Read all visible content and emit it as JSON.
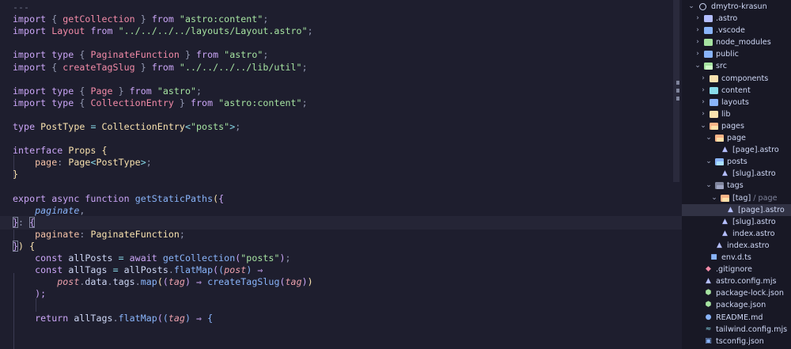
{
  "colors": {
    "editor_bg": "#1e1e2e",
    "sidebar_bg": "#181825",
    "keyword": "#cba6f7",
    "function": "#89b4fa",
    "type": "#f9e2af",
    "string": "#a6e3a1",
    "text": "#cdd6f4"
  },
  "explorer": {
    "root_label": "dmytro-krasun",
    "items": [
      {
        "label": "astro",
        "prefix": ".",
        "icon": "folder-astro-icon",
        "color": "#b4befe",
        "indent": 1,
        "chevron": "›",
        "kind": "folder"
      },
      {
        "label": ".vscode",
        "icon": "folder-vscode-icon",
        "color": "#89b4fa",
        "indent": 1,
        "chevron": "›",
        "kind": "folder"
      },
      {
        "label": "node_modules",
        "icon": "folder-node-icon",
        "color": "#a6e3a1",
        "indent": 1,
        "chevron": "›",
        "kind": "folder"
      },
      {
        "label": "public",
        "icon": "folder-public-icon",
        "color": "#89b4fa",
        "indent": 1,
        "chevron": "›",
        "kind": "folder"
      },
      {
        "label": "src",
        "icon": "folder-src-icon",
        "color": "#a6e3a1",
        "indent": 1,
        "chevron": "⌄",
        "kind": "folder-open"
      },
      {
        "label": "components",
        "icon": "folder-components-icon",
        "color": "#f9e2af",
        "indent": 2,
        "chevron": "›",
        "kind": "folder"
      },
      {
        "label": "content",
        "icon": "folder-content-icon",
        "color": "#89dceb",
        "indent": 2,
        "chevron": "›",
        "kind": "folder"
      },
      {
        "label": "layouts",
        "icon": "folder-layouts-icon",
        "color": "#89b4fa",
        "indent": 2,
        "chevron": "›",
        "kind": "folder"
      },
      {
        "label": "lib",
        "icon": "folder-lib-icon",
        "color": "#f9e2af",
        "indent": 2,
        "chevron": "›",
        "kind": "folder"
      },
      {
        "label": "pages",
        "icon": "folder-pages-icon",
        "color": "#fab387",
        "indent": 2,
        "chevron": "⌄",
        "kind": "folder-open"
      },
      {
        "label": "page",
        "icon": "folder-pages-icon",
        "color": "#fab387",
        "indent": 3,
        "chevron": "⌄",
        "kind": "folder-open"
      },
      {
        "label": "[page].astro",
        "icon": "astro-file-icon",
        "color": "#b4befe",
        "indent": 4,
        "chevron": "",
        "kind": "file"
      },
      {
        "label": "posts",
        "icon": "folder-posts-icon",
        "color": "#89b4fa",
        "indent": 3,
        "chevron": "⌄",
        "kind": "folder-open"
      },
      {
        "label": "[slug].astro",
        "icon": "astro-file-icon",
        "color": "#b4befe",
        "indent": 4,
        "chevron": "",
        "kind": "file"
      },
      {
        "label": "tags",
        "icon": "folder-tags-icon",
        "color": "#7f849c",
        "indent": 3,
        "chevron": "⌄",
        "kind": "folder-open"
      },
      {
        "label": "[tag]",
        "suffix": " / page",
        "icon": "folder-pages-icon",
        "color": "#fab387",
        "indent": 4,
        "chevron": "⌄",
        "kind": "folder-open"
      },
      {
        "label": "[page].astro",
        "icon": "astro-file-icon",
        "color": "#b4befe",
        "indent": 5,
        "chevron": "",
        "kind": "file",
        "selected": true
      },
      {
        "label": "[slug].astro",
        "icon": "astro-file-icon",
        "color": "#b4befe",
        "indent": 4,
        "chevron": "",
        "kind": "file"
      },
      {
        "label": "index.astro",
        "icon": "astro-file-icon",
        "color": "#b4befe",
        "indent": 4,
        "chevron": "",
        "kind": "file"
      },
      {
        "label": "index.astro",
        "icon": "astro-file-icon",
        "color": "#b4befe",
        "indent": 3,
        "chevron": "",
        "kind": "file"
      },
      {
        "label": "env.d.ts",
        "icon": "typescript-file-icon",
        "color": "#89b4fa",
        "indent": 2,
        "chevron": "",
        "kind": "file"
      },
      {
        "label": ".gitignore",
        "icon": "git-icon",
        "color": "#f38ba8",
        "indent": 1,
        "chevron": "",
        "kind": "file"
      },
      {
        "label": "astro.config.mjs",
        "icon": "astro-file-icon",
        "color": "#b4befe",
        "indent": 1,
        "chevron": "",
        "kind": "file"
      },
      {
        "label": "package-lock.json",
        "icon": "npm-icon",
        "color": "#a6e3a1",
        "indent": 1,
        "chevron": "",
        "kind": "file"
      },
      {
        "label": "package.json",
        "icon": "npm-icon",
        "color": "#a6e3a1",
        "indent": 1,
        "chevron": "",
        "kind": "file"
      },
      {
        "label": "README.md",
        "icon": "info-icon",
        "color": "#89b4fa",
        "indent": 1,
        "chevron": "",
        "kind": "file"
      },
      {
        "label": "tailwind.config.mjs",
        "icon": "tailwind-icon",
        "color": "#89dceb",
        "indent": 1,
        "chevron": "",
        "kind": "file"
      },
      {
        "label": "tsconfig.json",
        "icon": "tsconfig-icon",
        "color": "#89b4fa",
        "indent": 1,
        "chevron": "",
        "kind": "file"
      }
    ]
  },
  "editor": {
    "lines": [
      [
        [
          "---",
          "dim"
        ]
      ],
      [
        [
          "import",
          "kw"
        ],
        [
          " { ",
          "pu"
        ],
        [
          "getCollection",
          "pr"
        ],
        [
          " } ",
          "pu"
        ],
        [
          "from",
          "kw"
        ],
        [
          " ",
          "pl"
        ],
        [
          "\"astro:content\"",
          "str"
        ],
        [
          ";",
          "pu"
        ]
      ],
      [
        [
          "import",
          "kw"
        ],
        [
          " ",
          "pl"
        ],
        [
          "Layout",
          "pr"
        ],
        [
          " ",
          "pl"
        ],
        [
          "from",
          "kw"
        ],
        [
          " ",
          "pl"
        ],
        [
          "\"../../../../layouts/Layout.astro\"",
          "str"
        ],
        [
          ";",
          "pu"
        ]
      ],
      [],
      [
        [
          "import",
          "kw"
        ],
        [
          " ",
          "pl"
        ],
        [
          "type",
          "kw"
        ],
        [
          " { ",
          "pu"
        ],
        [
          "PaginateFunction",
          "pr"
        ],
        [
          " } ",
          "pu"
        ],
        [
          "from",
          "kw"
        ],
        [
          " ",
          "pl"
        ],
        [
          "\"astro\"",
          "str"
        ],
        [
          ";",
          "pu"
        ]
      ],
      [
        [
          "import",
          "kw"
        ],
        [
          " { ",
          "pu"
        ],
        [
          "createTagSlug",
          "pr"
        ],
        [
          " } ",
          "pu"
        ],
        [
          "from",
          "kw"
        ],
        [
          " ",
          "pl"
        ],
        [
          "\"../../../../lib/util\"",
          "str"
        ],
        [
          ";",
          "pu"
        ]
      ],
      [],
      [
        [
          "import",
          "kw"
        ],
        [
          " ",
          "pl"
        ],
        [
          "type",
          "kw"
        ],
        [
          " { ",
          "pu"
        ],
        [
          "Page",
          "pr"
        ],
        [
          " } ",
          "pu"
        ],
        [
          "from",
          "kw"
        ],
        [
          " ",
          "pl"
        ],
        [
          "\"astro\"",
          "str"
        ],
        [
          ";",
          "pu"
        ]
      ],
      [
        [
          "import",
          "kw"
        ],
        [
          " ",
          "pl"
        ],
        [
          "type",
          "kw"
        ],
        [
          " { ",
          "pu"
        ],
        [
          "CollectionEntry",
          "pr"
        ],
        [
          " } ",
          "pu"
        ],
        [
          "from",
          "kw"
        ],
        [
          " ",
          "pl"
        ],
        [
          "\"astro:content\"",
          "str"
        ],
        [
          ";",
          "pu"
        ]
      ],
      [],
      [
        [
          "type",
          "kw"
        ],
        [
          " ",
          "pl"
        ],
        [
          "PostType",
          "ty"
        ],
        [
          " ",
          "pl"
        ],
        [
          "=",
          "op"
        ],
        [
          " ",
          "pl"
        ],
        [
          "CollectionEntry",
          "ty"
        ],
        [
          "<",
          "op"
        ],
        [
          "\"posts\"",
          "str"
        ],
        [
          ">",
          "op"
        ],
        [
          ";",
          "pu"
        ]
      ],
      [],
      [
        [
          "interface",
          "kw"
        ],
        [
          " ",
          "pl"
        ],
        [
          "Props",
          "ty"
        ],
        [
          " ",
          "pl"
        ],
        [
          "{",
          "br1"
        ]
      ],
      [
        [
          "    ",
          "pl"
        ],
        [
          "page",
          "prk"
        ],
        [
          ": ",
          "pu"
        ],
        [
          "Page",
          "ty"
        ],
        [
          "<",
          "op"
        ],
        [
          "PostType",
          "ty"
        ],
        [
          ">",
          "op"
        ],
        [
          ";",
          "pu"
        ]
      ],
      [
        [
          "}",
          "br1"
        ]
      ],
      [],
      [
        [
          "export",
          "kw"
        ],
        [
          " ",
          "pl"
        ],
        [
          "async",
          "kw"
        ],
        [
          " ",
          "pl"
        ],
        [
          "function",
          "kw"
        ],
        [
          " ",
          "pl"
        ],
        [
          "getStaticPaths",
          "fn"
        ],
        [
          "(",
          "br1"
        ],
        [
          "{",
          "br2"
        ]
      ],
      [
        [
          "    ",
          "pl"
        ],
        [
          "paginate",
          "prop"
        ],
        [
          ",",
          "pu"
        ]
      ],
      [
        [
          "}",
          "br2box"
        ],
        [
          ": ",
          "pu"
        ],
        [
          "{",
          "br2box"
        ]
      ],
      [
        [
          "    ",
          "pl"
        ],
        [
          "paginate",
          "prk"
        ],
        [
          ": ",
          "pu"
        ],
        [
          "PaginateFunction",
          "ty"
        ],
        [
          ";",
          "pu"
        ]
      ],
      [
        [
          "}",
          "br2box"
        ],
        [
          ") ",
          "br1"
        ],
        [
          "{",
          "br1"
        ]
      ],
      [
        [
          "    ",
          "pl"
        ],
        [
          "const",
          "kw"
        ],
        [
          " ",
          "pl"
        ],
        [
          "allPosts",
          "pl"
        ],
        [
          " ",
          "pl"
        ],
        [
          "=",
          "op"
        ],
        [
          " ",
          "pl"
        ],
        [
          "await",
          "kw"
        ],
        [
          " ",
          "pl"
        ],
        [
          "getCollection",
          "fn"
        ],
        [
          "(",
          "br2"
        ],
        [
          "\"posts\"",
          "str"
        ],
        [
          ")",
          "br2"
        ],
        [
          ";",
          "pu"
        ]
      ],
      [
        [
          "    ",
          "pl"
        ],
        [
          "const",
          "kw"
        ],
        [
          " ",
          "pl"
        ],
        [
          "allTags",
          "pl"
        ],
        [
          " ",
          "pl"
        ],
        [
          "=",
          "op"
        ],
        [
          " ",
          "pl"
        ],
        [
          "allPosts",
          "pl"
        ],
        [
          ".",
          "pu"
        ],
        [
          "flatMap",
          "fn"
        ],
        [
          "(",
          "br2"
        ],
        [
          "(",
          "br3"
        ],
        [
          "post",
          "par"
        ],
        [
          ")",
          "br3"
        ],
        [
          " ⇒",
          "kw"
        ]
      ],
      [
        [
          "        ",
          "pl"
        ],
        [
          "post",
          "par"
        ],
        [
          ".",
          "pu"
        ],
        [
          "data",
          "pl"
        ],
        [
          ".",
          "pu"
        ],
        [
          "tags",
          "pl"
        ],
        [
          ".",
          "pu"
        ],
        [
          "map",
          "fn"
        ],
        [
          "(",
          "br1"
        ],
        [
          "(",
          "br2"
        ],
        [
          "tag",
          "par"
        ],
        [
          ")",
          "br2"
        ],
        [
          " ⇒ ",
          "kw"
        ],
        [
          "createTagSlug",
          "fn"
        ],
        [
          "(",
          "br2"
        ],
        [
          "tag",
          "par"
        ],
        [
          ")",
          "br2"
        ],
        [
          ")",
          "br1"
        ]
      ],
      [
        [
          "    ",
          "pl"
        ],
        [
          ");",
          "br2"
        ]
      ],
      [],
      [
        [
          "    ",
          "pl"
        ],
        [
          "return",
          "kw"
        ],
        [
          " ",
          "pl"
        ],
        [
          "allTags",
          "pl"
        ],
        [
          ".",
          "pu"
        ],
        [
          "flatMap",
          "fn"
        ],
        [
          "(",
          "br2"
        ],
        [
          "(",
          "br3"
        ],
        [
          "tag",
          "par"
        ],
        [
          ")",
          "br3"
        ],
        [
          " ⇒ ",
          "kw"
        ],
        [
          "{",
          "br3"
        ]
      ]
    ]
  }
}
